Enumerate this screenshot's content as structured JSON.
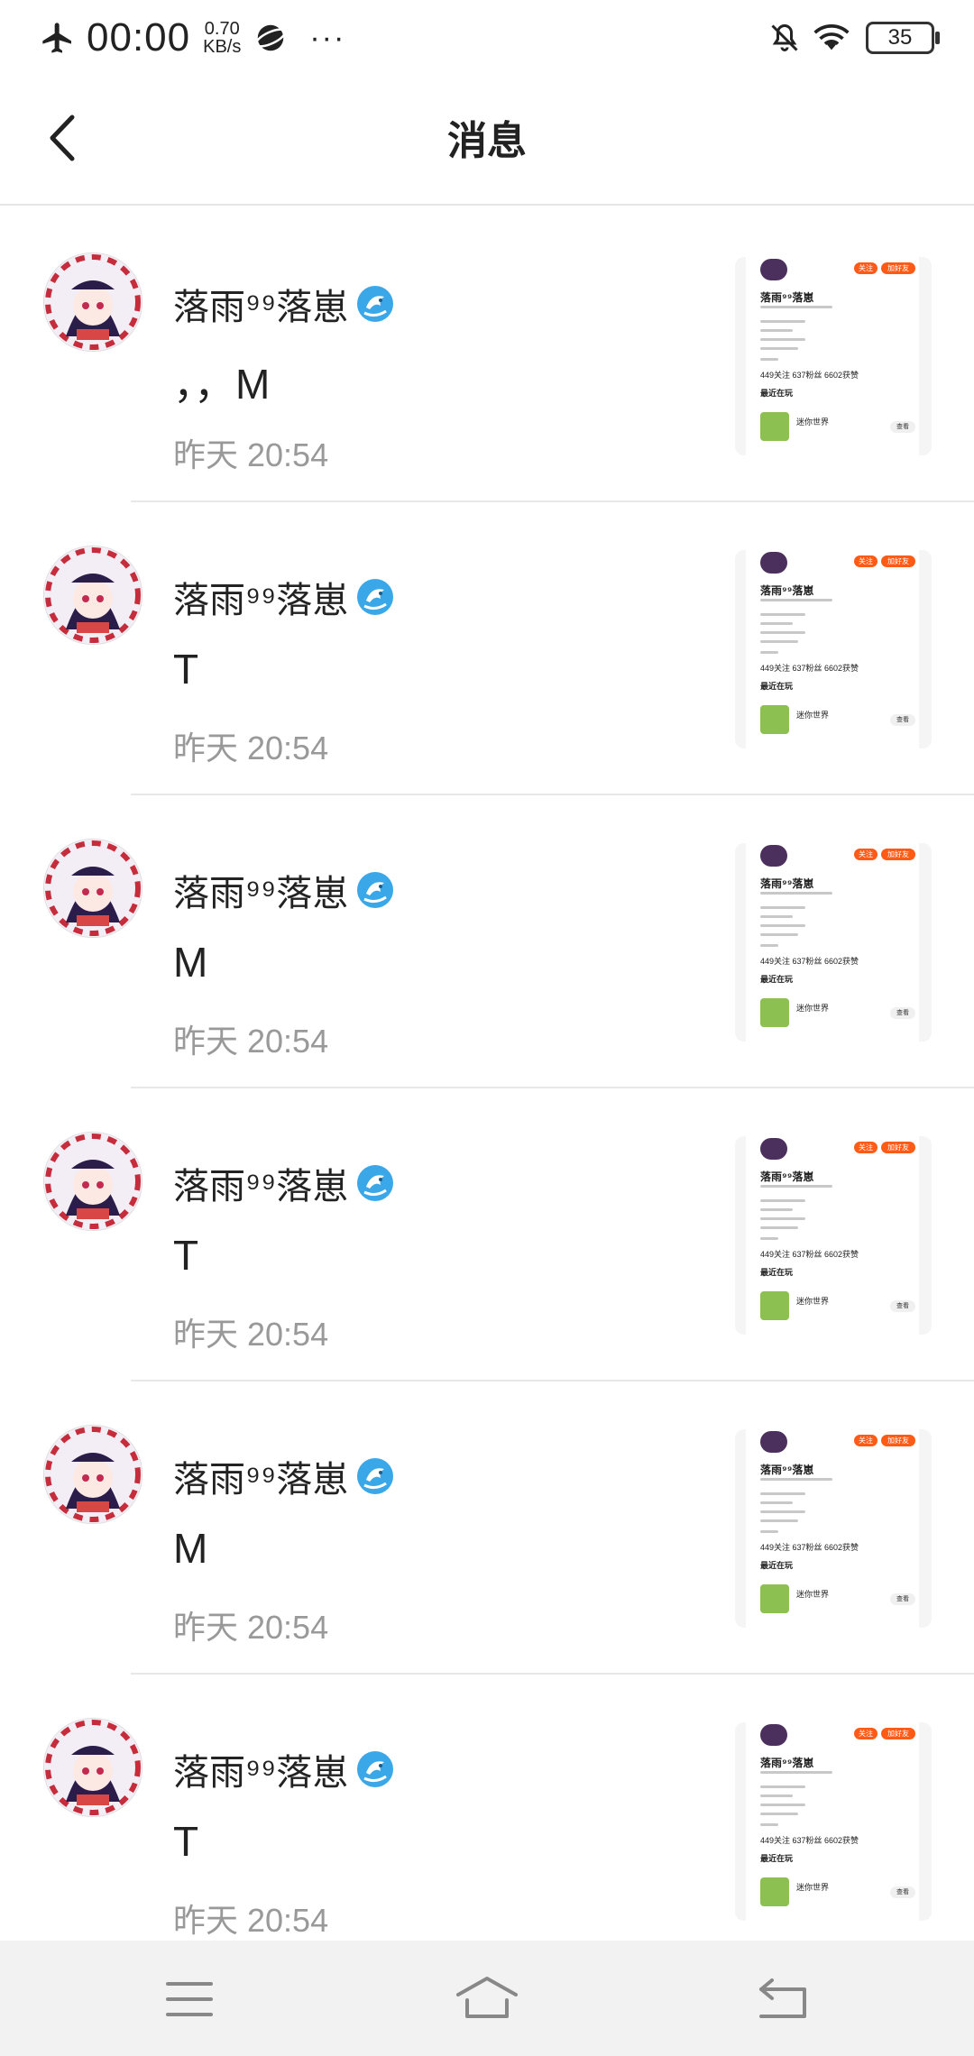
{
  "status_bar": {
    "time": "00:00",
    "speed_value": "0.70",
    "speed_unit": "KB/s",
    "more": "···",
    "battery": "35"
  },
  "header": {
    "title": "消息"
  },
  "thumbnail": {
    "name": "落雨⁹⁹落崽",
    "follow": "关注",
    "add_friend": "加好友",
    "stats": "449关注  637粉丝  6602获赞",
    "recent": "最近在玩",
    "game": "迷你世界",
    "view": "查看"
  },
  "messages": [
    {
      "name": "落雨⁹⁹落崽",
      "text": "，，M",
      "time": "昨天 20:54"
    },
    {
      "name": "落雨⁹⁹落崽",
      "text": "T",
      "time": "昨天 20:54"
    },
    {
      "name": "落雨⁹⁹落崽",
      "text": "M",
      "time": "昨天 20:54"
    },
    {
      "name": "落雨⁹⁹落崽",
      "text": "T",
      "time": "昨天 20:54"
    },
    {
      "name": "落雨⁹⁹落崽",
      "text": "M",
      "time": "昨天 20:54"
    },
    {
      "name": "落雨⁹⁹落崽",
      "text": "T",
      "time": "昨天 20:54"
    }
  ],
  "colors": {
    "accent": "#ff5b16",
    "time_gray": "#999999",
    "nav_bg": "#f2f2f2"
  },
  "icons": {
    "airplane": "airplane-icon",
    "planet": "planet-icon",
    "mute": "bell-muted-icon",
    "wifi": "wifi-icon",
    "back": "chevron-left-icon",
    "menu": "menu-icon",
    "home": "home-icon",
    "return": "return-icon"
  }
}
